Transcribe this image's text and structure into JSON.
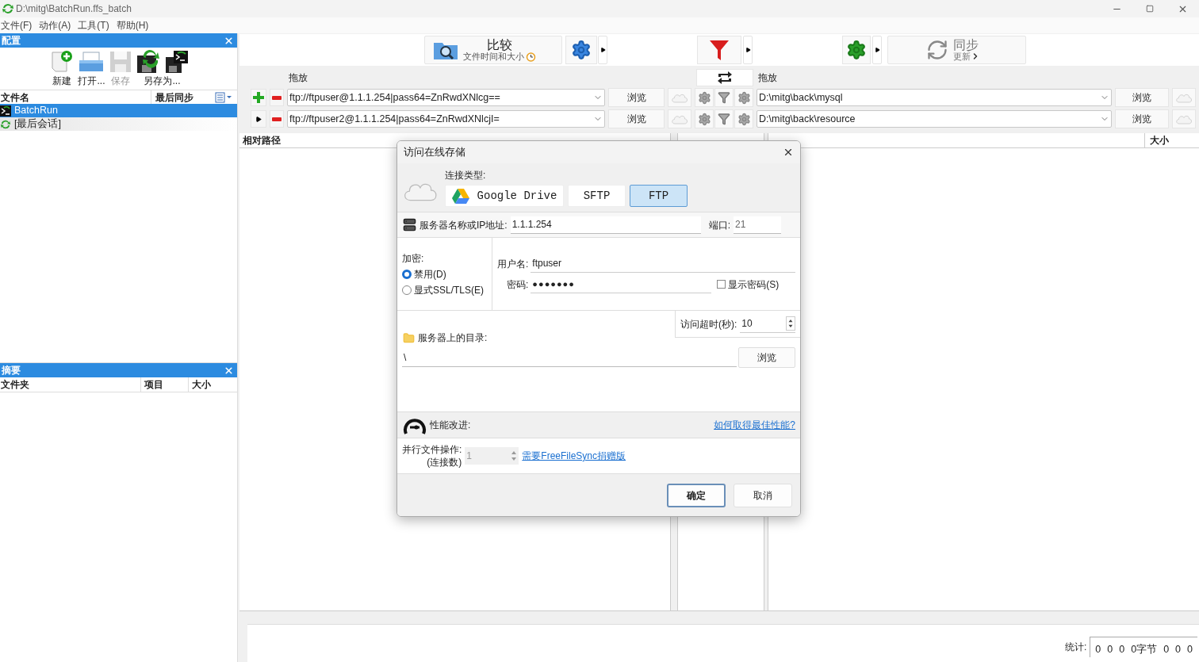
{
  "window": {
    "title": "D:\\mitg\\BatchRun.ffs_batch"
  },
  "menu": [
    "文件(F)",
    "动作(A)",
    "工具(T)",
    "帮助(H)"
  ],
  "config_panel": {
    "title": "配置",
    "toolbar": [
      {
        "label": "新建",
        "kind": "new",
        "disabled": false
      },
      {
        "label": "打开...",
        "kind": "open",
        "disabled": false
      },
      {
        "label": "保存",
        "kind": "save",
        "disabled": true
      },
      {
        "label": "另存为...",
        "kind": "saveas",
        "disabled": false
      }
    ],
    "columns": [
      "文件名",
      "最后同步"
    ],
    "rows": [
      {
        "name": "BatchRun",
        "kind": "batch",
        "selected": true
      },
      {
        "name": "[最后会话]",
        "kind": "session",
        "selected": false
      }
    ]
  },
  "summary_panel": {
    "title": "摘要",
    "columns": [
      "文件夹",
      "项目",
      "大小"
    ]
  },
  "toolbar": {
    "compare": {
      "label": "比较",
      "sublabel": "文件时间和大小"
    },
    "sync": {
      "label": "同步",
      "sublabel": "更新"
    }
  },
  "folder_pairs": {
    "left_header": "拖放",
    "right_header": "拖放",
    "rows": [
      {
        "kind": "add",
        "left": "ftp://ftpuser@1.1.1.254|pass64=ZnRwdXNlcg==",
        "left_browse": "浏览",
        "right": "D:\\mitg\\back\\mysql",
        "right_browse": "浏览"
      },
      {
        "kind": "expand",
        "left": "ftp://ftpuser2@1.1.1.254|pass64=ZnRwdXNlcjI=",
        "left_browse": "浏览",
        "right": "D:\\mitg\\back\\resource",
        "right_browse": "浏览"
      }
    ]
  },
  "grid": {
    "left_columns": [
      "相对路径"
    ],
    "right_columns": [
      "大小"
    ]
  },
  "status": {
    "label": "统计:",
    "values": [
      "0",
      "0",
      "0",
      "0字节",
      "0",
      "0",
      "0"
    ]
  },
  "dialog": {
    "title": "访问在线存储",
    "connection_type_label": "连接类型:",
    "types": [
      {
        "label": "Google Drive",
        "kind": "gdrive",
        "selected": false
      },
      {
        "label": "SFTP",
        "kind": "plain",
        "selected": false
      },
      {
        "label": "FTP",
        "kind": "plain",
        "selected": true
      }
    ],
    "server_label": "服务器名称或IP地址:",
    "server": "1.1.1.254",
    "port_label": "端口:",
    "port": "21",
    "encryption_label": "加密:",
    "encryption_options": [
      {
        "label": "禁用(D)",
        "selected": true
      },
      {
        "label": "显式SSL/TLS(E)",
        "selected": false
      }
    ],
    "username_label": "用户名:",
    "username": "ftpuser",
    "password_label": "密码:",
    "password": "●●●●●●●",
    "show_password": {
      "label": "显示密码(S)",
      "checked": false
    },
    "timeout_label": "访问超时(秒):",
    "timeout": "10",
    "directory_label": "服务器上的目录:",
    "directory": "\\",
    "directory_browse": "浏览",
    "performance_label": "性能改进:",
    "performance_link": "如何取得最佳性能?",
    "parallel_label": "并行文件操作:",
    "parallel_sublabel": "(连接数)",
    "parallel": "1",
    "donation_link": "需要FreeFileSync捐赠版",
    "ok": "确定",
    "cancel": "取消"
  }
}
